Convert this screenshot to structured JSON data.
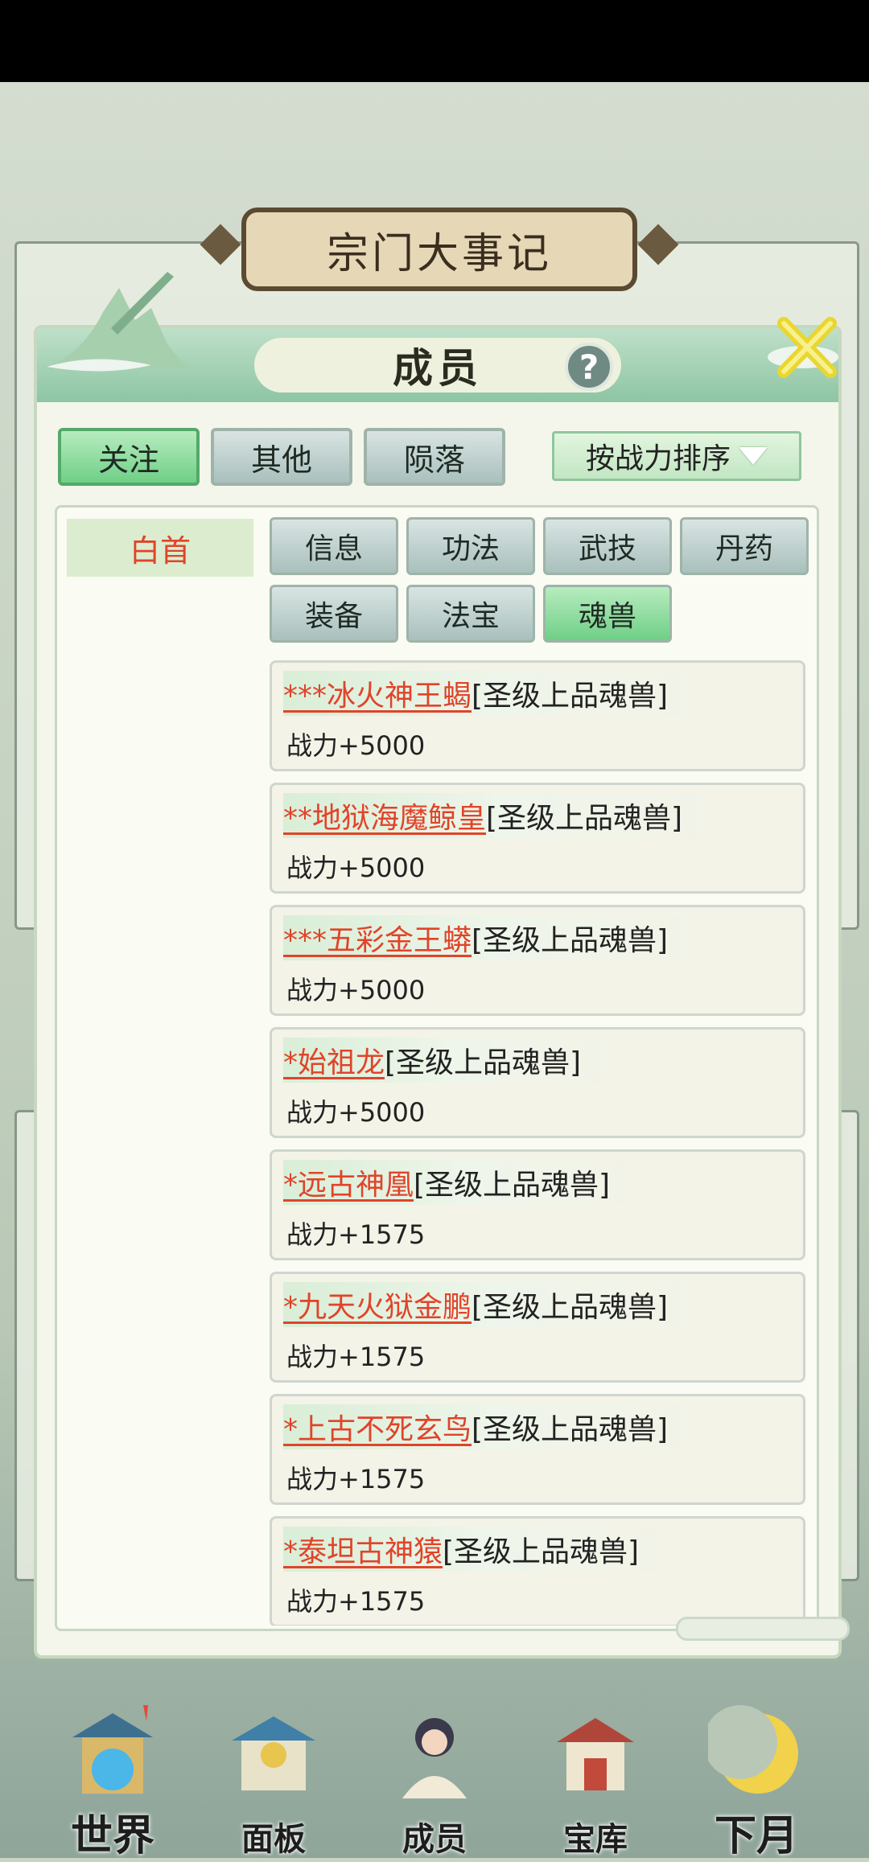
{
  "background": {
    "title": "宗门大事记"
  },
  "modal": {
    "title": "成员",
    "help_icon": "?",
    "filters": [
      {
        "label": "关注",
        "active": true
      },
      {
        "label": "其他",
        "active": false
      },
      {
        "label": "陨落",
        "active": false
      }
    ],
    "sort_label": "按战力排序",
    "member_name": "白首",
    "categories": [
      {
        "label": "信息",
        "active": false
      },
      {
        "label": "功法",
        "active": false
      },
      {
        "label": "武技",
        "active": false
      },
      {
        "label": "丹药",
        "active": false
      },
      {
        "label": "装备",
        "active": false
      },
      {
        "label": "法宝",
        "active": false
      },
      {
        "label": "魂兽",
        "active": true
      }
    ],
    "beasts": [
      {
        "name": "***冰火神王蝎",
        "grade": "[圣级上品魂兽]",
        "power": "战力+5000"
      },
      {
        "name": "**地狱海魔鲸皇",
        "grade": "[圣级上品魂兽]",
        "power": "战力+5000"
      },
      {
        "name": "***五彩金王蟒",
        "grade": "[圣级上品魂兽]",
        "power": "战力+5000"
      },
      {
        "name": "*始祖龙",
        "grade": "[圣级上品魂兽]",
        "power": "战力+5000"
      },
      {
        "name": "*远古神凰",
        "grade": "[圣级上品魂兽]",
        "power": "战力+1575"
      },
      {
        "name": "*九天火狱金鹏",
        "grade": "[圣级上品魂兽]",
        "power": "战力+1575"
      },
      {
        "name": "*上古不死玄鸟",
        "grade": "[圣级上品魂兽]",
        "power": "战力+1575"
      },
      {
        "name": "*泰坦古神猿",
        "grade": "[圣级上品魂兽]",
        "power": "战力+1575"
      }
    ]
  },
  "nav": [
    {
      "label": "世界",
      "icon": "world-pagoda-icon"
    },
    {
      "label": "面板",
      "icon": "panel-shrine-icon"
    },
    {
      "label": "成员",
      "icon": "member-portrait-icon"
    },
    {
      "label": "宝库",
      "icon": "treasury-icon"
    },
    {
      "label": "下月",
      "icon": "crescent-moon-icon"
    }
  ],
  "colors": {
    "accent_green": "#6fcf86",
    "name_red": "#e0442a",
    "panel_bg": "#f4f6ec"
  }
}
